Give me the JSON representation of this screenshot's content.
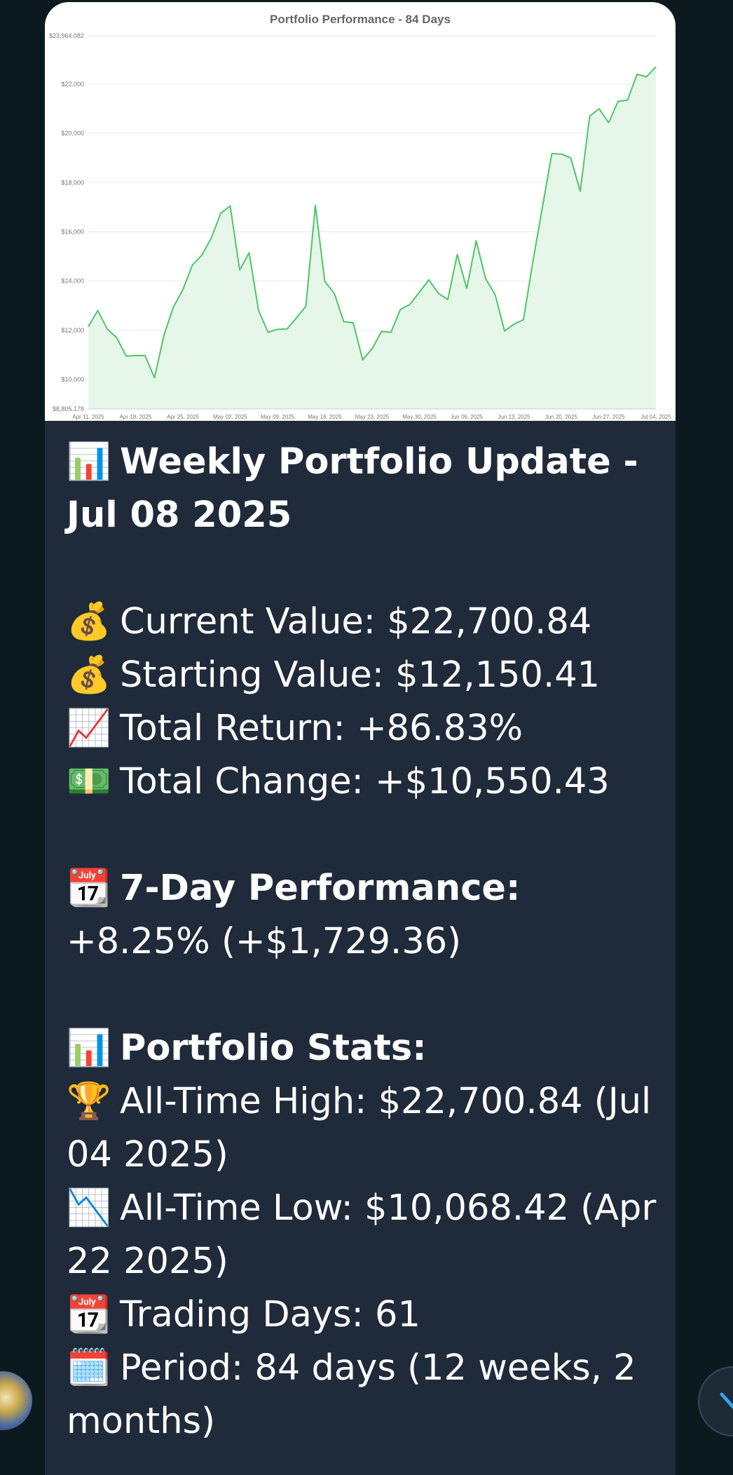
{
  "chart_data": {
    "type": "area",
    "title": "Portfolio Performance - 84 Days",
    "xlabel": "",
    "ylabel": "",
    "ylim": [
      8805.178,
      23964.082
    ],
    "yticks": [
      "$23,964.082",
      "$22,000",
      "$20,000",
      "$18,000",
      "$16,000",
      "$14,000",
      "$12,000",
      "$10,000",
      "$8,805.178"
    ],
    "ytick_values": [
      23964.082,
      22000,
      20000,
      18000,
      16000,
      14000,
      12000,
      10000,
      8805.178
    ],
    "xticks": [
      "Apr 11, 2025",
      "Apr 18, 2025",
      "Apr 25, 2025",
      "May 02, 2025",
      "May 09, 2025",
      "May 16, 2025",
      "May 23, 2025",
      "May 30, 2025",
      "Jun 06, 2025",
      "Jun 13, 2025",
      "Jun 20, 2025",
      "Jun 27, 2025",
      "Jul 04, 2025"
    ],
    "grid": true,
    "line_color": "#4cc765",
    "fill_color": "#e6f7ea",
    "values": [
      12150,
      12800,
      12050,
      11700,
      10950,
      10970,
      10970,
      10070,
      11800,
      12950,
      13650,
      14650,
      15050,
      15750,
      16750,
      17050,
      14450,
      15150,
      12800,
      11920,
      12040,
      12050,
      12500,
      12980,
      17080,
      13980,
      13500,
      12350,
      12300,
      10800,
      11250,
      11950,
      11920,
      12850,
      13050,
      13550,
      14050,
      13500,
      13250,
      15080,
      13700,
      15630,
      14100,
      13450,
      11970,
      12250,
      12430,
      14800,
      17000,
      19180,
      19160,
      19000,
      17650,
      20700,
      21000,
      20430,
      21300,
      21350,
      22400,
      22300,
      22700.84
    ]
  },
  "message": {
    "title_emoji": "📊",
    "title": "Weekly Portfolio Update - Jul 08 2025",
    "current_emoji": "💰",
    "current": "Current Value: $22,700.84",
    "starting_emoji": "💰",
    "starting": "Starting Value: $12,150.41",
    "return_emoji": "📈",
    "total_return": "Total Return: +86.83%",
    "change_emoji": "💵",
    "total_change": "Total Change: +$10,550.43",
    "week_emoji": "📆",
    "week_heading": "7-Day Performance:",
    "week_value": "+8.25% (+$1,729.36)",
    "stats_emoji": "📊",
    "stats_heading": "Portfolio Stats:",
    "ath_emoji": "🏆",
    "ath": "All-Time High: $22,700.84 (Jul 04 2025)",
    "atl_emoji": "📉",
    "atl": "All-Time Low: $10,068.42 (Apr 22 2025)",
    "days_emoji": "📆",
    "trading_days": "Trading Days: 61",
    "period_emoji": "🗓️",
    "period": "Period: 84 days (12 weeks, 2 months)"
  }
}
